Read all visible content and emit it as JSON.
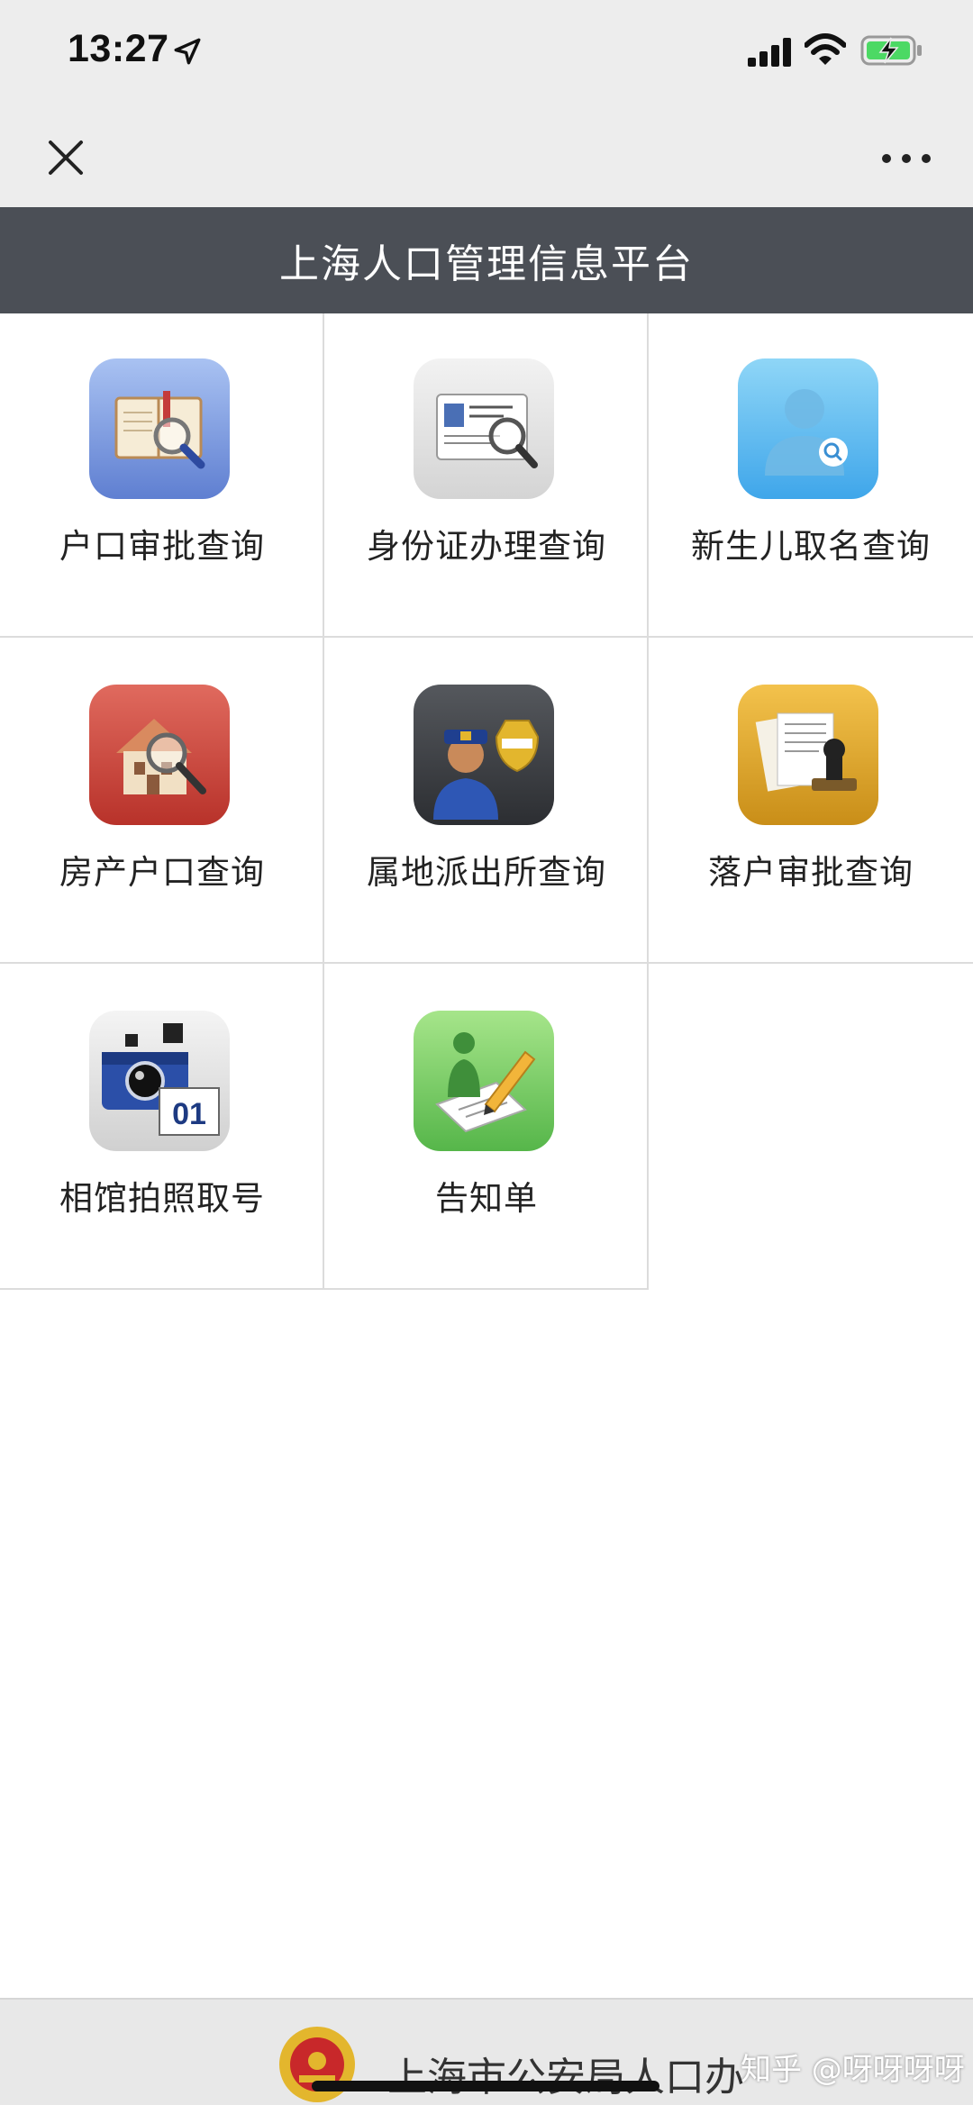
{
  "status_bar": {
    "time": "13:27",
    "icons": [
      "location-arrow-icon",
      "signal-icon",
      "wifi-icon",
      "battery-charging-icon"
    ]
  },
  "nav": {
    "close_icon": "close-icon",
    "more_icon": "more-icon"
  },
  "header": {
    "title": "上海人口管理信息平台",
    "background": "#4b4f56"
  },
  "grid": {
    "items": [
      {
        "label": "户口审批查询",
        "icon": "household-book-icon"
      },
      {
        "label": "身份证办理查询",
        "icon": "id-card-icon"
      },
      {
        "label": "新生儿取名查询",
        "icon": "person-search-icon"
      },
      {
        "label": "房产户口查询",
        "icon": "house-search-icon"
      },
      {
        "label": "属地派出所查询",
        "icon": "police-icon"
      },
      {
        "label": "落户审批查询",
        "icon": "stamp-documents-icon"
      },
      {
        "label": "相馆拍照取号",
        "icon": "camera-number-icon"
      },
      {
        "label": "告知单",
        "icon": "notice-form-icon"
      }
    ]
  },
  "footer": {
    "text": "上海市公安局人口办",
    "watermark": "知乎 @呀呀呀呀"
  }
}
